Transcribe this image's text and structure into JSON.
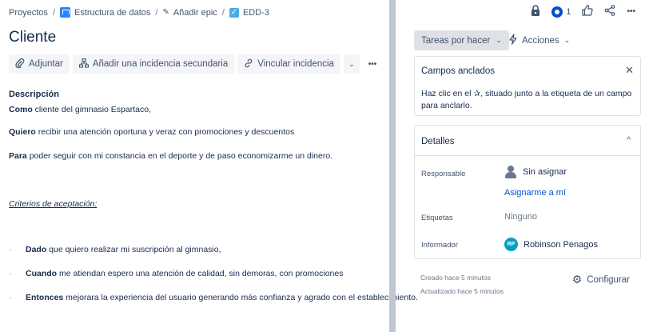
{
  "breadcrumb": {
    "projects": "Proyectos",
    "project": "Estructura de datos",
    "epic": "Añadir epic",
    "issue_key": "EDD-3",
    "separator": "/"
  },
  "issue": {
    "title": "Cliente"
  },
  "toolbar": {
    "attach": "Adjuntar",
    "add_child": "Añadir una incidencia secundaria",
    "link_issue": "Vincular incidencia",
    "more": "•••"
  },
  "description": {
    "heading": "Descripción",
    "p1_bold": "Como",
    "p1_rest": " cliente del gimnasio Espartaco,",
    "p2_bold": "Quiero",
    "p2_rest": " recibir una atención oportuna y veraz con promociones y descuentos",
    "p3_bold": "Para",
    "p3_rest": " poder seguir con mi constancia en el deporte y de paso economizarme un dinero.",
    "criteria": "Criterios de aceptación:",
    "bullets": [
      {
        "bold": "Dado",
        "rest": " que quiero realizar mi suscripción al gimnasio,"
      },
      {
        "bold": "Cuando",
        "rest": " me atiendan espero una atención de calidad, sin demoras, con promociones"
      },
      {
        "bold": "Entonces",
        "rest": " mejorara la experiencia del usuario generando más confianza y agrado con el establecimiento."
      }
    ],
    "bullet_marker": "·"
  },
  "header_actions": {
    "watch_count": "1",
    "icons": [
      "lock-icon",
      "watch-icon",
      "thumbs-up-icon",
      "share-icon",
      "more-icon"
    ]
  },
  "status": {
    "label": "Tareas por hacer",
    "actions_label": "Acciones"
  },
  "pinned_fields": {
    "heading": "Campos anclados",
    "hint": "Haz clic en el ✰, situado junto a la etiqueta de un campo para anclarlo."
  },
  "details": {
    "heading": "Detalles",
    "assignee_label": "Responsable",
    "assignee_value": "Sin asignar",
    "assign_to_me": "Asignarme a mí",
    "labels_label": "Etiquetas",
    "labels_value": "Ninguno",
    "reporter_label": "Informador",
    "reporter_value": "Robinson Penagos",
    "reporter_initials": "RP"
  },
  "meta": {
    "created": "Creado hace 5 minutos",
    "updated": "Actualizado hace 5 minutos",
    "configure": "Configurar"
  },
  "colors": {
    "brand_blue": "#0052cc",
    "text": "#172b4d",
    "muted": "#6b778c",
    "avatar": "#00a3bf"
  }
}
